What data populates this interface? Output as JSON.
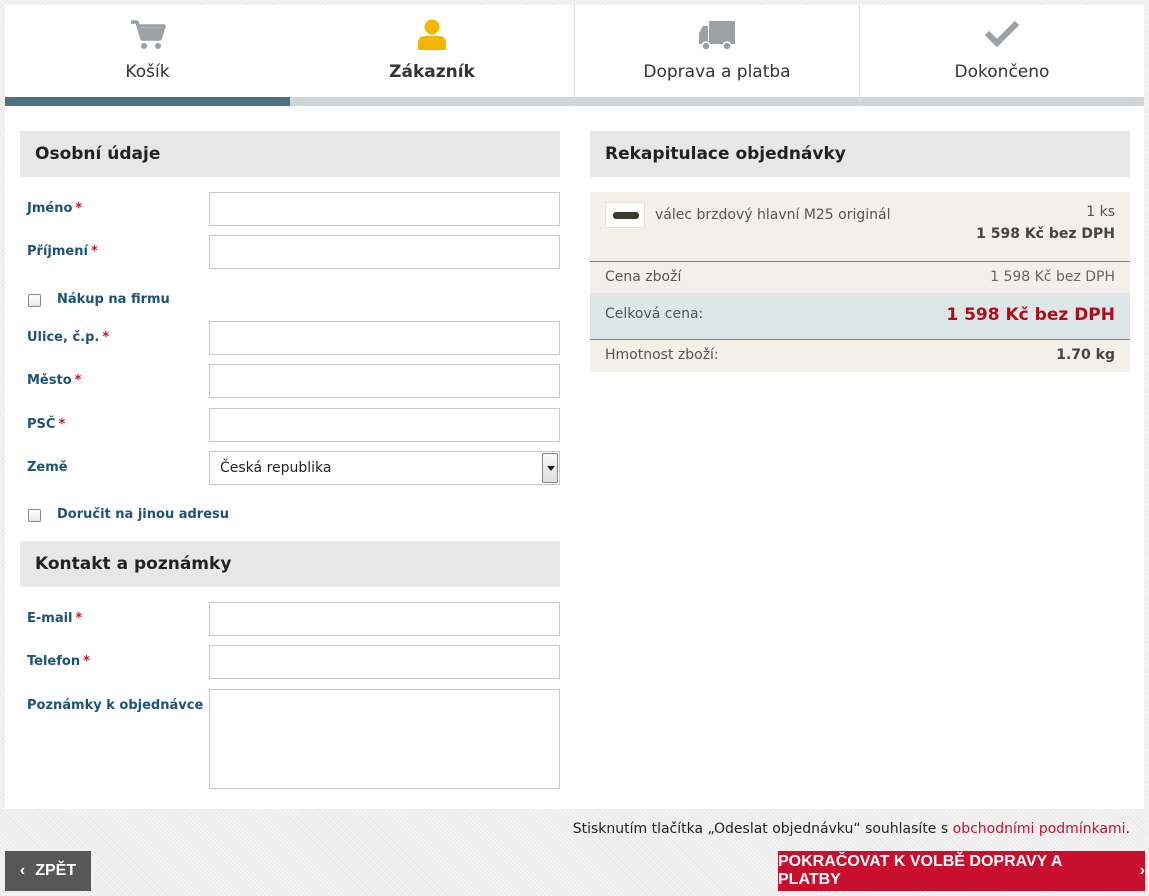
{
  "steps": [
    {
      "label": "Košík",
      "icon": "cart-icon",
      "state": "done"
    },
    {
      "label": "Zákazník",
      "icon": "user-icon",
      "state": "active"
    },
    {
      "label": "Doprava a platba",
      "icon": "truck-icon",
      "state": "todo"
    },
    {
      "label": "Dokončeno",
      "icon": "checkmark-icon",
      "state": "todo"
    }
  ],
  "colors": {
    "accent": "#c8102e",
    "progress": "#4c7285",
    "active_icon": "#f3b700",
    "inactive_icon": "#9aa0a3",
    "label": "#1d5378"
  },
  "personal": {
    "title": "Osobní údaje",
    "first_name": {
      "label": "Jméno",
      "required": "*",
      "value": ""
    },
    "last_name": {
      "label": "Příjmení",
      "required": "*",
      "value": ""
    },
    "company_purchase": {
      "label": "Nákup na firmu",
      "checked": false
    },
    "street": {
      "label": "Ulice, č.p.",
      "required": "*",
      "value": ""
    },
    "city": {
      "label": "Město",
      "required": "*",
      "value": ""
    },
    "zip": {
      "label": "PSČ",
      "required": "*",
      "value": ""
    },
    "country": {
      "label": "Země",
      "value": "Česká republika"
    },
    "other_address": {
      "label": "Doručit na jinou adresu",
      "checked": false
    }
  },
  "contact": {
    "title": "Kontakt a poznámky",
    "email": {
      "label": "E-mail",
      "required": "*",
      "value": ""
    },
    "phone": {
      "label": "Telefon",
      "required": "*",
      "value": ""
    },
    "notes": {
      "label": "Poznámky k objednávce",
      "value": ""
    }
  },
  "summary": {
    "title": "Rekapitulace objednávky",
    "item": {
      "name": "válec brzdový hlavní M25 originál",
      "qty": "1 ks",
      "price": "1 598 Kč bez DPH"
    },
    "goods_price_label": "Cena zboží",
    "goods_price": "1 598 Kč bez DPH",
    "total_label": "Celková cena:",
    "total": "1 598 Kč bez DPH",
    "weight_label": "Hmotnost zboží:",
    "weight": "1.70 kg"
  },
  "footer": {
    "terms_text": "Stisknutím tlačítka „Odeslat objednávku“ souhlasíte s ",
    "terms_link": "obchodními podmínkami",
    "terms_end": ".",
    "back_label": "ZPĚT",
    "next_label": "POKRAČOVAT K VOLBĚ DOPRAVY A PLATBY"
  }
}
